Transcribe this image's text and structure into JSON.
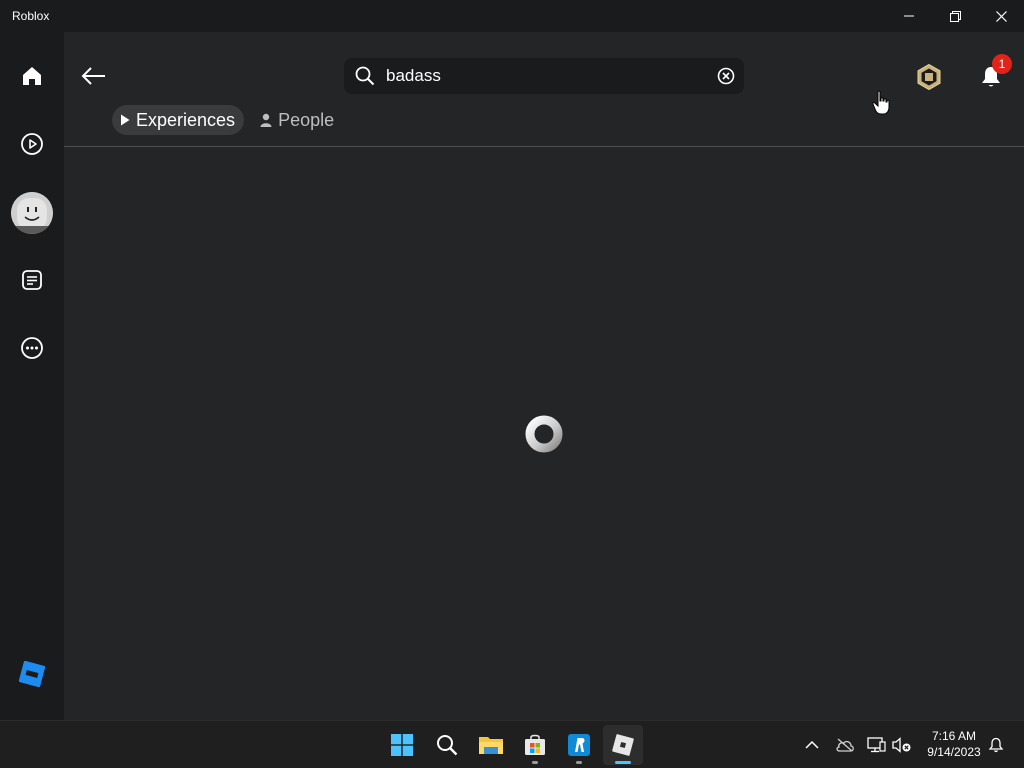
{
  "window": {
    "title": "Roblox"
  },
  "sidebar": {
    "items": [
      {
        "name": "home",
        "icon": "home-icon"
      },
      {
        "name": "discover",
        "icon": "play-circle-icon"
      },
      {
        "name": "avatar",
        "icon": "avatar-icon"
      },
      {
        "name": "chat",
        "icon": "chat-icon"
      },
      {
        "name": "more",
        "icon": "more-icon"
      }
    ]
  },
  "search": {
    "query": "badass",
    "placeholder": "Search"
  },
  "notifications": {
    "count": "1"
  },
  "tabs": [
    {
      "label": "Experiences",
      "icon": "play-triangle-icon",
      "active": true
    },
    {
      "label": "People",
      "icon": "person-icon",
      "active": false
    }
  ],
  "status": {
    "loading": true
  },
  "taskbar": {
    "apps": [
      "windows-start",
      "search",
      "file-explorer",
      "microsoft-store",
      "roblox-r",
      "roblox"
    ],
    "time": "7:16 AM",
    "date": "9/14/2023"
  },
  "colors": {
    "background": "#232527",
    "sidebar": "#191b1d",
    "badge": "#e2231a",
    "accent": "#4cc2ff"
  }
}
